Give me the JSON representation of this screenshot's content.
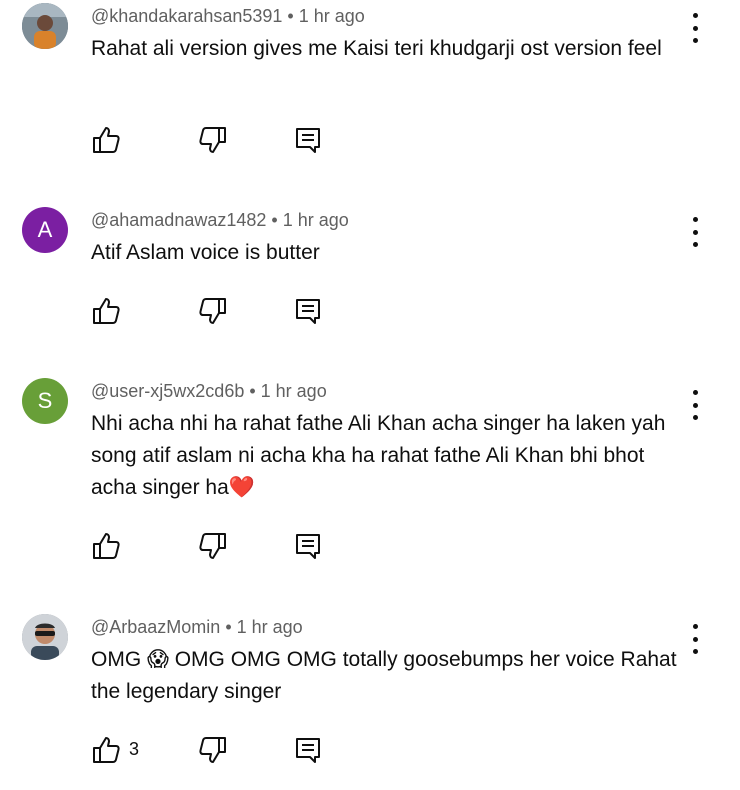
{
  "comments": [
    {
      "author": "@khandakarahsan5391",
      "time": "1 hr ago",
      "text": "Rahat ali version gives me Kaisi teri khudgarji ost version feel",
      "avatar_letter": "",
      "avatar_color": "#5a6b7d",
      "likes": ""
    },
    {
      "author": "@ahamadnawaz1482",
      "time": "1 hr ago",
      "text": "Atif Aslam voice is butter",
      "avatar_letter": "A",
      "avatar_color": "#7b1fa2",
      "likes": ""
    },
    {
      "author": "@user-xj5wx2cd6b",
      "time": "1 hr ago",
      "text": "Nhi acha nhi ha rahat fathe Ali Khan acha singer ha laken yah song atif aslam ni acha kha ha rahat fathe Ali Khan bhi bhot acha singer ha❤️",
      "avatar_letter": "S",
      "avatar_color": "#689f38",
      "likes": ""
    },
    {
      "author": "@ArbaazMomin",
      "time": "1 hr ago",
      "text": "OMG 😱 OMG OMG OMG totally goosebumps her voice Rahat the legendary singer",
      "avatar_letter": "",
      "avatar_color": "#8a8f96",
      "likes": "3"
    }
  ],
  "separator": " • ",
  "icons": {
    "like": "thumb-up-icon",
    "dislike": "thumb-down-icon",
    "reply": "reply-icon",
    "menu": "more-vert-icon"
  }
}
